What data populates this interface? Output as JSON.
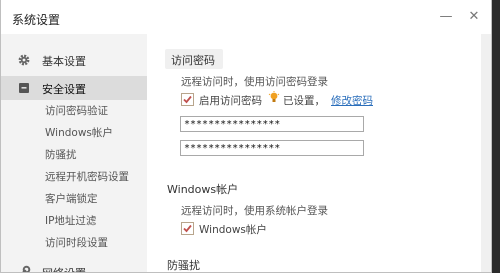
{
  "window": {
    "title": "系统设置",
    "minimize_glyph": "—",
    "close_glyph": "✕"
  },
  "sidebar": {
    "items": [
      {
        "label": "基本设置",
        "icon": "gear-icon"
      },
      {
        "label": "安全设置",
        "icon": "shield-icon",
        "active": true
      },
      {
        "label": "网络设置",
        "icon": "wrench-icon"
      }
    ],
    "sub_items": [
      "访问密码验证",
      "Windows帐户",
      "防骚扰",
      "远程开机密码设置",
      "客户端锁定",
      "IP地址过滤",
      "访问时段设置"
    ]
  },
  "content": {
    "access_password": {
      "heading": "访问密码",
      "description": "远程访问时，使用访问密码登录",
      "checkbox_label": "启用访问密码",
      "checked": true,
      "status_text": "已设置，",
      "modify_link": "修改密码",
      "password_1": "****************",
      "password_2": "****************"
    },
    "windows_account": {
      "heading": "Windows帐户",
      "description": "远程访问时，使用系统帐户登录",
      "checkbox_label": "Windows帐户",
      "checked": true
    },
    "anti_harass": {
      "heading": "防骚扰"
    }
  },
  "colors": {
    "accent_link": "#2a6ebb",
    "active_item_bg": "#dcdcdc",
    "sidebar_bg": "#f3f3f3",
    "check_mark": "#c0504d",
    "lightbulb": "#f0a020"
  }
}
